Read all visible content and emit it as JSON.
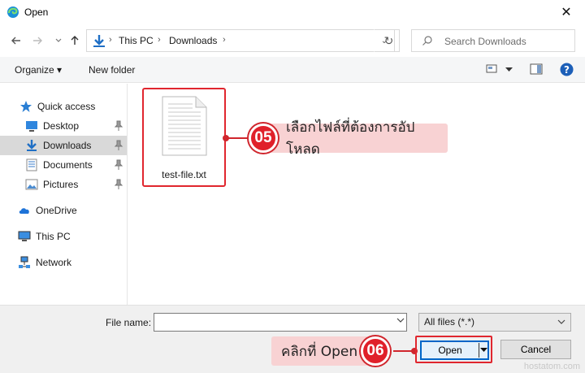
{
  "window": {
    "title": "Open",
    "close_glyph": "✕"
  },
  "address": {
    "crumbs": [
      "This PC",
      "Downloads"
    ],
    "separators": [
      "›",
      "›",
      "›"
    ],
    "dropdown_glyph": "⌄",
    "refresh_glyph": "↻"
  },
  "search": {
    "placeholder": "Search Downloads"
  },
  "toolbar": {
    "organize": "Organize ▾",
    "new_folder": "New folder"
  },
  "sidebar": {
    "items": [
      {
        "label": "Quick access"
      },
      {
        "label": "Desktop"
      },
      {
        "label": "Downloads"
      },
      {
        "label": "Documents"
      },
      {
        "label": "Pictures"
      },
      {
        "label": "OneDrive"
      },
      {
        "label": "This PC"
      },
      {
        "label": "Network"
      }
    ],
    "selected": "Downloads"
  },
  "files": [
    {
      "name": "test-file.txt"
    }
  ],
  "annotations": {
    "step1": {
      "number": "05",
      "text": "เลือกไฟล์ที่ต้องการอัปโหลด"
    },
    "step2": {
      "number": "06",
      "text": "คลิกที่ Open"
    }
  },
  "bottom": {
    "file_name_label": "File name:",
    "file_name_value": "",
    "filter_value": "All files (*.*)",
    "open_label": "Open",
    "cancel_label": "Cancel"
  },
  "watermark": "hostatom.com",
  "colors": {
    "accent": "#0067c0",
    "annotation": "#e0202a",
    "callout_bg": "#f8d2d3"
  }
}
